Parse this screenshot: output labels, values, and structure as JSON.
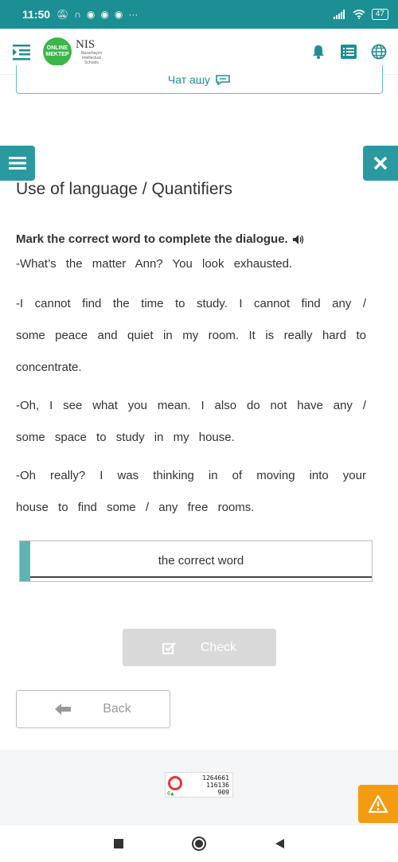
{
  "status_bar": {
    "time": "11:50",
    "left_icons": [
      "mute-icon",
      "headphones-icon",
      "chrome-icon",
      "chrome-icon",
      "chrome-icon"
    ],
    "more": "···",
    "battery": "47"
  },
  "header": {
    "logo_line1": "ONLINE",
    "logo_line2": "MEKTEP",
    "nis_title": "NIS",
    "nis_subtitle": "Nazarbayev Intellectual Schools"
  },
  "chat_button": {
    "label": "Чат ашу"
  },
  "exercise": {
    "title": "Use of language / Quantifiers",
    "instruction": "Mark the correct word to complete the dialogue.",
    "lines": [
      "-What’s the matter Ann? You look exhausted.",
      "-I cannot find the time to study. I cannot find any / some peace and quiet in my room. It is really hard to concentrate.",
      "-Oh, I see what you mean. I also do not have any / some space to study in my house.",
      "-Oh really? I was thinking in of moving into your house to find some / any free rooms."
    ],
    "answer_placeholder": "the correct word"
  },
  "buttons": {
    "check": "Check",
    "back": "Back"
  },
  "counter": {
    "line1": "1264661",
    "line2": "116136",
    "line3": "909",
    "small": "6"
  },
  "colors": {
    "status_bar": "#1b8f94",
    "accent": "#2a9aa0",
    "warning": "#f39c12"
  }
}
